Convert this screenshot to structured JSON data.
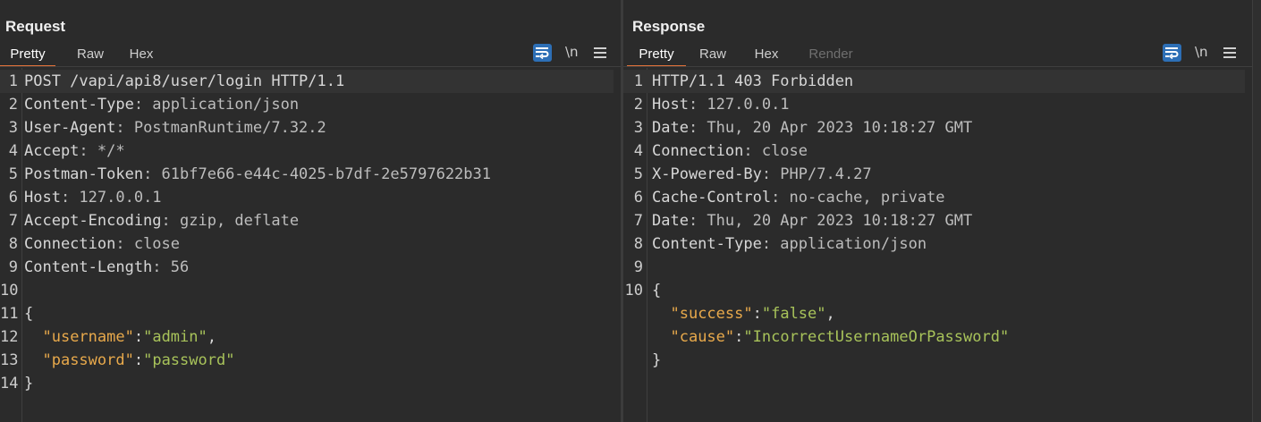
{
  "request": {
    "title": "Request",
    "tabs": [
      "Pretty",
      "Raw",
      "Hex"
    ],
    "lines": [
      {
        "n": "1",
        "parts": [
          {
            "t": "POST /vapi/api8/user/login HTTP/1.1",
            "c": "k"
          }
        ]
      },
      {
        "n": "2",
        "parts": [
          {
            "t": "Content-Type",
            "c": "k"
          },
          {
            "t": ": application/json",
            "c": "v"
          }
        ]
      },
      {
        "n": "3",
        "parts": [
          {
            "t": "User-Agent",
            "c": "k"
          },
          {
            "t": ": PostmanRuntime/7.32.2",
            "c": "v"
          }
        ]
      },
      {
        "n": "4",
        "parts": [
          {
            "t": "Accept",
            "c": "k"
          },
          {
            "t": ": */*",
            "c": "v"
          }
        ]
      },
      {
        "n": "5",
        "parts": [
          {
            "t": "Postman-Token",
            "c": "k"
          },
          {
            "t": ": 61bf7e66-e44c-4025-b7df-2e5797622b31",
            "c": "v"
          }
        ]
      },
      {
        "n": "6",
        "parts": [
          {
            "t": "Host",
            "c": "k"
          },
          {
            "t": ": 127.0.0.1",
            "c": "v"
          }
        ]
      },
      {
        "n": "7",
        "parts": [
          {
            "t": "Accept-Encoding",
            "c": "k"
          },
          {
            "t": ": gzip, deflate",
            "c": "v"
          }
        ]
      },
      {
        "n": "8",
        "parts": [
          {
            "t": "Connection",
            "c": "k"
          },
          {
            "t": ": close",
            "c": "v"
          }
        ]
      },
      {
        "n": "9",
        "parts": [
          {
            "t": "Content-Length",
            "c": "k"
          },
          {
            "t": ": 56",
            "c": "v"
          }
        ]
      },
      {
        "n": "10",
        "parts": []
      },
      {
        "n": "11",
        "parts": [
          {
            "t": "{",
            "c": "p"
          }
        ]
      },
      {
        "n": "12",
        "parts": [
          {
            "t": "  ",
            "c": "p"
          },
          {
            "t": "\"username\"",
            "c": "jk"
          },
          {
            "t": ":",
            "c": "p"
          },
          {
            "t": "\"admin\"",
            "c": "s"
          },
          {
            "t": ",",
            "c": "p"
          }
        ]
      },
      {
        "n": "13",
        "parts": [
          {
            "t": "  ",
            "c": "p"
          },
          {
            "t": "\"password\"",
            "c": "jk"
          },
          {
            "t": ":",
            "c": "p"
          },
          {
            "t": "\"password\"",
            "c": "s"
          }
        ]
      },
      {
        "n": "14",
        "parts": [
          {
            "t": "}",
            "c": "p"
          }
        ]
      }
    ]
  },
  "response": {
    "title": "Response",
    "tabs": [
      "Pretty",
      "Raw",
      "Hex",
      "Render"
    ],
    "lines": [
      {
        "n": "1",
        "parts": [
          {
            "t": "HTTP/1.1 403 Forbidden",
            "c": "k"
          }
        ]
      },
      {
        "n": "2",
        "parts": [
          {
            "t": "Host",
            "c": "k"
          },
          {
            "t": ": 127.0.0.1",
            "c": "v"
          }
        ]
      },
      {
        "n": "3",
        "parts": [
          {
            "t": "Date",
            "c": "k"
          },
          {
            "t": ": Thu, 20 Apr 2023 10:18:27 GMT",
            "c": "v"
          }
        ]
      },
      {
        "n": "4",
        "parts": [
          {
            "t": "Connection",
            "c": "k"
          },
          {
            "t": ": close",
            "c": "v"
          }
        ]
      },
      {
        "n": "5",
        "parts": [
          {
            "t": "X-Powered-By",
            "c": "k"
          },
          {
            "t": ": PHP/7.4.27",
            "c": "v"
          }
        ]
      },
      {
        "n": "6",
        "parts": [
          {
            "t": "Cache-Control",
            "c": "k"
          },
          {
            "t": ": no-cache, private",
            "c": "v"
          }
        ]
      },
      {
        "n": "7",
        "parts": [
          {
            "t": "Date",
            "c": "k"
          },
          {
            "t": ": Thu, 20 Apr 2023 10:18:27 GMT",
            "c": "v"
          }
        ]
      },
      {
        "n": "8",
        "parts": [
          {
            "t": "Content-Type",
            "c": "k"
          },
          {
            "t": ": application/json",
            "c": "v"
          }
        ]
      },
      {
        "n": "9",
        "parts": []
      },
      {
        "n": "10",
        "parts": [
          {
            "t": "{",
            "c": "p"
          }
        ]
      },
      {
        "n": "",
        "parts": [
          {
            "t": "  ",
            "c": "p"
          },
          {
            "t": "\"success\"",
            "c": "jk"
          },
          {
            "t": ":",
            "c": "p"
          },
          {
            "t": "\"false\"",
            "c": "s"
          },
          {
            "t": ",",
            "c": "p"
          }
        ]
      },
      {
        "n": "",
        "parts": [
          {
            "t": "  ",
            "c": "p"
          },
          {
            "t": "\"cause\"",
            "c": "jk"
          },
          {
            "t": ":",
            "c": "p"
          },
          {
            "t": "\"IncorrectUsernameOrPassword\"",
            "c": "s"
          }
        ]
      },
      {
        "n": "",
        "parts": [
          {
            "t": "}",
            "c": "p"
          }
        ]
      }
    ]
  },
  "toolbar": {
    "newline_label": "\\n"
  },
  "icons": {
    "wrap": "word-wrap-icon",
    "menu": "hamburger-menu-icon",
    "layout_side": "layout-side-by-side-icon",
    "layout_stacked": "layout-stacked-icon",
    "layout_single": "layout-single-icon"
  },
  "colors": {
    "background": "#2b2b2b",
    "accent": "#e8743b",
    "active_button": "#2d6fb6",
    "json_key": "#e8a94b",
    "json_string": "#a8c35a"
  }
}
